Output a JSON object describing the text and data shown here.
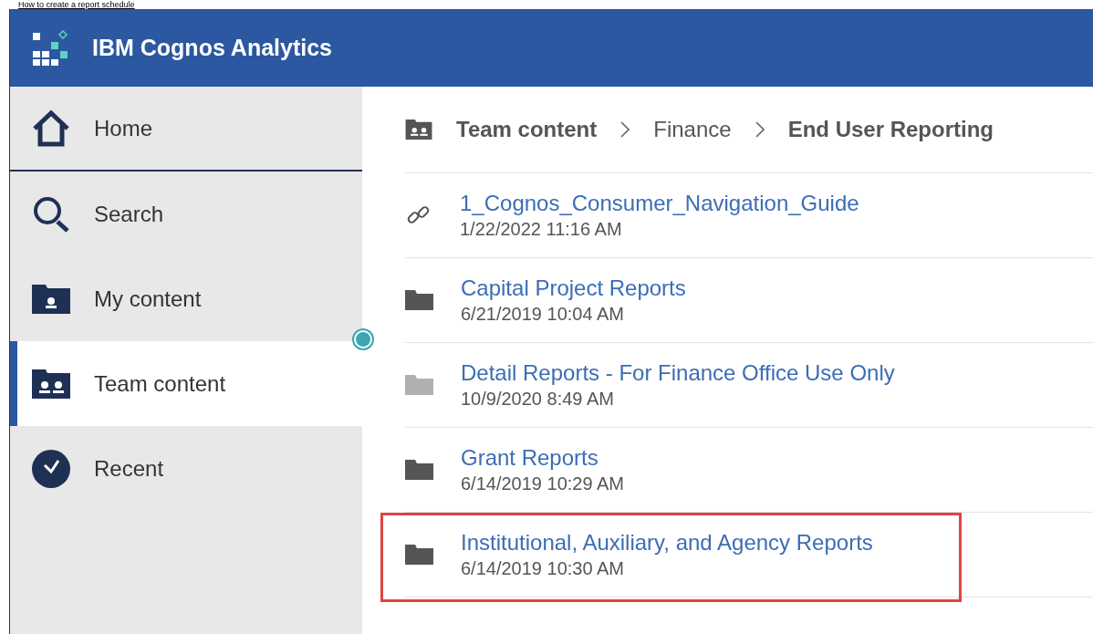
{
  "page_heading": "How to create a report schedule",
  "app": {
    "title": "IBM Cognos Analytics"
  },
  "sidebar": {
    "items": [
      {
        "kind": "home",
        "label": "Home",
        "selected": false
      },
      {
        "kind": "search",
        "label": "Search",
        "selected": false
      },
      {
        "kind": "my-content",
        "label": "My content",
        "selected": false
      },
      {
        "kind": "team-content",
        "label": "Team content",
        "selected": true
      },
      {
        "kind": "recent",
        "label": "Recent",
        "selected": false
      }
    ]
  },
  "breadcrumb": [
    {
      "label": "Team content",
      "bold": true
    },
    {
      "label": "Finance",
      "bold": false
    },
    {
      "label": "End User Reporting",
      "bold": true
    }
  ],
  "items": [
    {
      "kind": "link",
      "name": "1_Cognos_Consumer_Navigation_Guide",
      "modified": "1/22/2022 11:16 AM",
      "dimmed": false,
      "highlighted": false
    },
    {
      "kind": "folder",
      "name": "Capital Project Reports",
      "modified": "6/21/2019 10:04 AM",
      "dimmed": false,
      "highlighted": false
    },
    {
      "kind": "folder",
      "name": "Detail Reports - For Finance Office Use Only",
      "modified": "10/9/2020 8:49 AM",
      "dimmed": true,
      "highlighted": false
    },
    {
      "kind": "folder",
      "name": "Grant Reports",
      "modified": "6/14/2019 10:29 AM",
      "dimmed": false,
      "highlighted": false
    },
    {
      "kind": "folder",
      "name": "Institutional, Auxiliary, and Agency Reports",
      "modified": "6/14/2019 10:30 AM",
      "dimmed": false,
      "highlighted": true
    }
  ]
}
